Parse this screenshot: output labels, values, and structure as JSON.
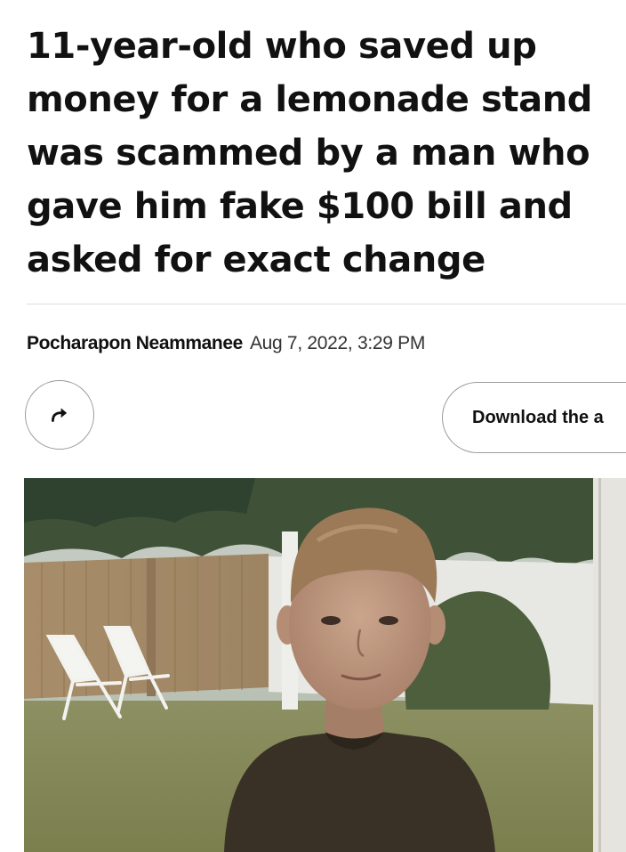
{
  "article": {
    "headline_lines": [
      "11-year-old who saved up",
      "money for a lemonade stand",
      "was scammed by a man who",
      "gave him fake $100 bill and",
      "asked for exact change"
    ],
    "author": "Pocharapon Neammanee",
    "date": "Aug 7, 2022, 3:29 PM"
  },
  "actions": {
    "share_icon": "share-arrow-icon",
    "download_label": "Download the a"
  },
  "photo": {
    "subject": "boy"
  }
}
